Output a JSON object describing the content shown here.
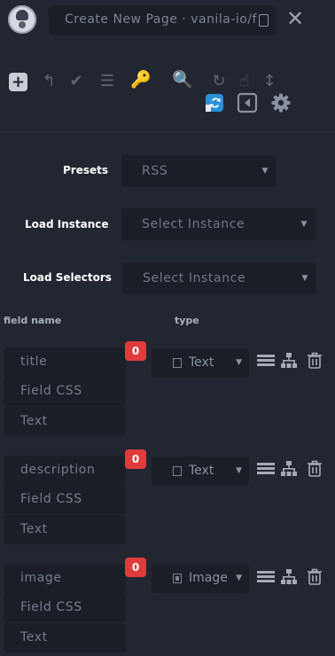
{
  "header": {
    "title": "Create New Page · vanila-io/f",
    "close_label": "✕"
  },
  "toolbar": {
    "plus_label": "+",
    "return_glyph": "↰",
    "check_glyph": "✔",
    "list_glyph": "☰",
    "key_glyph": "🔑",
    "search_glyph": "🔍",
    "refresh_glyph": "↻",
    "pointer_glyph": "☝",
    "resize_glyph": "↕",
    "colors": {
      "key": "#f0a500",
      "search": "#ff4fa0",
      "sync": "#2a8fd8"
    }
  },
  "form": {
    "presets": {
      "label": "Presets",
      "value": "RSS"
    },
    "load_instance": {
      "label": "Load Instance",
      "placeholder": "Select Instance"
    },
    "load_selectors": {
      "label": "Load Selectors",
      "placeholder": "Select Instance"
    }
  },
  "columns": {
    "field_name": "field name",
    "type": "type"
  },
  "fields": [
    {
      "name": "title",
      "css": "Field CSS",
      "attr": "Text",
      "count": "0",
      "type": "Text"
    },
    {
      "name": "description",
      "css": "Field CSS",
      "attr": "Text",
      "count": "0",
      "type": "Text"
    },
    {
      "name": "image",
      "css": "Field CSS",
      "attr": "Text",
      "count": "0",
      "type": "Image"
    }
  ],
  "colors": {
    "background": "#222631",
    "input": "#1b1e27",
    "badge": "#e03b3b"
  }
}
